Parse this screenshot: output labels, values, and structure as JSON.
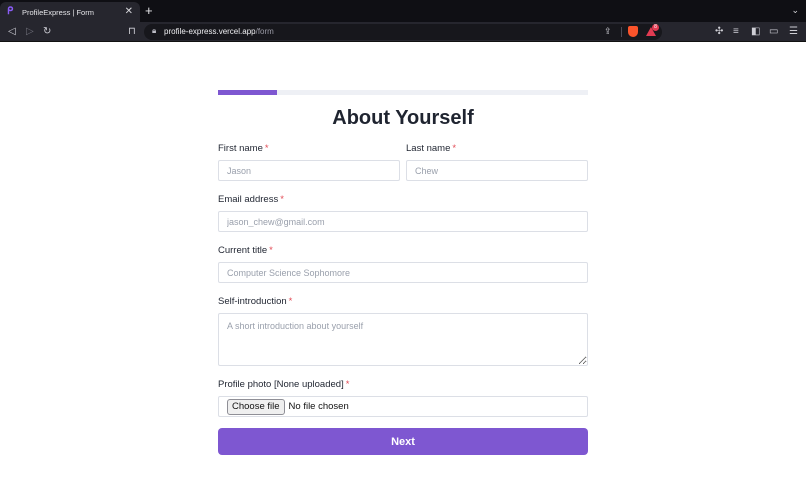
{
  "browser": {
    "tab_title": "ProfileExpress | Form",
    "tab_favicon": "ᑭ",
    "url_host": "profile-express.vercel.app",
    "url_path": "/form",
    "icons": [
      "back-icon",
      "forward-icon",
      "reload-icon",
      "bookmark-icon",
      "lock-icon",
      "share-icon",
      "brave-shield-icon",
      "brave-rewards-icon",
      "extensions-icon",
      "playlist-icon",
      "sidebar-icon",
      "wallet-icon",
      "menu-icon"
    ],
    "rewards_count": "8"
  },
  "form": {
    "progress": 0.16,
    "title": "About Yourself",
    "required_mark": "*",
    "first_name": {
      "label": "First name",
      "placeholder": "Jason"
    },
    "last_name": {
      "label": "Last name",
      "placeholder": "Chew"
    },
    "email": {
      "label": "Email address",
      "placeholder": "jason_chew@gmail.com"
    },
    "current_title": {
      "label": "Current title",
      "placeholder": "Computer Science Sophomore"
    },
    "intro": {
      "label": "Self-introduction",
      "placeholder": "A short introduction about yourself"
    },
    "photo": {
      "label": "Profile photo [None uploaded]",
      "button": "Choose file",
      "status": "No file chosen"
    },
    "next_label": "Next"
  },
  "colors": {
    "accent": "#7e57d1",
    "required": "#e24b55"
  }
}
